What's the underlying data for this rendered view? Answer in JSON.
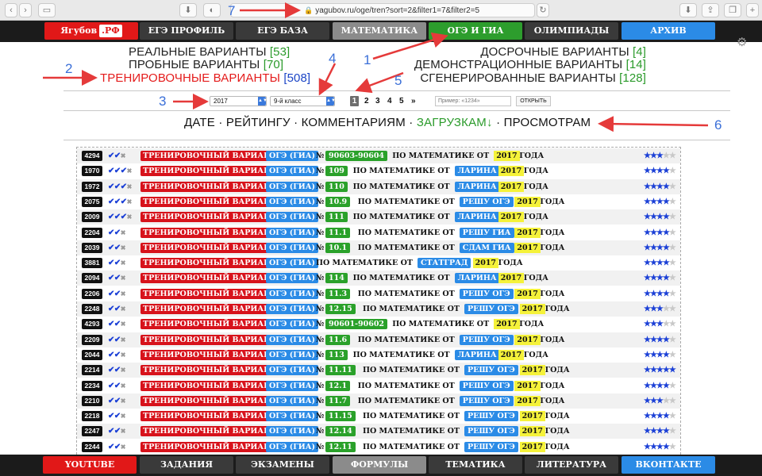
{
  "browser": {
    "url": "yagubov.ru/oge/tren?sort=2&filter1=7&filter2=5"
  },
  "top_nav": {
    "logo_text": "Ягубов",
    "logo_suffix": ".РФ",
    "items": [
      "ЕГЭ ПРОФИЛЬ",
      "ЕГЭ БАЗА",
      "МАТЕМАТИКА",
      "ОГЭ И ГИА",
      "ОЛИМПИАДЫ",
      "АРХИВ"
    ]
  },
  "categories": {
    "left": [
      {
        "label": "РЕАЛЬНЫЕ ВАРИАНТЫ",
        "count": "[53]"
      },
      {
        "label": "ПРОБНЫЕ ВАРИАНТЫ",
        "count": "[70]"
      },
      {
        "label": "ТРЕНИРОВОЧНЫЕ ВАРИАНТЫ",
        "count": "[508]"
      }
    ],
    "right": [
      {
        "label": "ДОСРОЧНЫЕ ВАРИАНТЫ",
        "count": "[4]"
      },
      {
        "label": "ДЕМОНСТРАЦИОННЫЕ ВАРИАНТЫ",
        "count": "[14]"
      },
      {
        "label": "СГЕНЕРИРОВАННЫЕ ВАРИАНТЫ",
        "count": "[128]"
      }
    ]
  },
  "filters": {
    "year": "2017",
    "grade": "9-й класс",
    "pages": [
      "1",
      "2",
      "3",
      "4",
      "5",
      "»"
    ],
    "current_page": "1",
    "search_placeholder": "Пример: «1234»",
    "open_label": "ОТКРЫТЬ"
  },
  "sort": {
    "prefix": "ДАТЕ · РЕЙТИНГУ · КОММЕНТАРИЯМ ·",
    "active": "ЗАГРУЗКАМ↓",
    "suffix": "· ПРОСМОТРАМ"
  },
  "row_text": {
    "type": "ТРЕНИРОВОЧНЫЙ ВАРИАНТ",
    "exam": "ОГЭ (ГИА)",
    "num_sign": "№",
    "subject": "ПО МАТЕМАТИКЕ",
    "from": "ОТ",
    "year_word": "ГОДА"
  },
  "rows": [
    {
      "id": "4294",
      "checks": "✔✔",
      "num": "90603-90604",
      "source": "",
      "year": "2017",
      "stars": 3
    },
    {
      "id": "1970",
      "checks": "✔✔✔",
      "num": "109",
      "source": "ЛАРИНА",
      "year": "2017",
      "stars": 4
    },
    {
      "id": "1972",
      "checks": "✔✔✔",
      "num": "110",
      "source": "ЛАРИНА",
      "year": "2017",
      "stars": 4
    },
    {
      "id": "2075",
      "checks": "✔✔✔",
      "num": "10.9",
      "source": "РЕШУ ОГЭ",
      "year": "2017",
      "stars": 4
    },
    {
      "id": "2009",
      "checks": "✔✔✔",
      "num": "111",
      "source": "ЛАРИНА",
      "year": "2017",
      "stars": 4
    },
    {
      "id": "2204",
      "checks": "✔✔",
      "num": "11.1",
      "source": "РЕШУ ГИА",
      "year": "2017",
      "stars": 4
    },
    {
      "id": "2039",
      "checks": "✔✔",
      "num": "10.1",
      "source": "СДАМ ГИА",
      "year": "2017",
      "stars": 4
    },
    {
      "id": "3881",
      "checks": "✔✔",
      "num": "",
      "source": "СТАТГРАД",
      "year": "2017",
      "stars": 4
    },
    {
      "id": "2094",
      "checks": "✔✔",
      "num": "114",
      "source": "ЛАРИНА",
      "year": "2017",
      "stars": 4
    },
    {
      "id": "2206",
      "checks": "✔✔",
      "num": "11.3",
      "source": "РЕШУ ОГЭ",
      "year": "2017",
      "stars": 4
    },
    {
      "id": "2248",
      "checks": "✔✔",
      "num": "12.15",
      "source": "РЕШУ ОГЭ",
      "year": "2017",
      "stars": 3
    },
    {
      "id": "4293",
      "checks": "✔✔",
      "num": "90601-90602",
      "source": "",
      "year": "2017",
      "stars": 3
    },
    {
      "id": "2209",
      "checks": "✔✔",
      "num": "11.6",
      "source": "РЕШУ ОГЭ",
      "year": "2017",
      "stars": 4
    },
    {
      "id": "2044",
      "checks": "✔✔",
      "num": "113",
      "source": "ЛАРИНА",
      "year": "2017",
      "stars": 4
    },
    {
      "id": "2214",
      "checks": "✔✔",
      "num": "11.11",
      "source": "РЕШУ ОГЭ",
      "year": "2017",
      "stars": 5
    },
    {
      "id": "2234",
      "checks": "✔✔",
      "num": "12.1",
      "source": "РЕШУ ОГЭ",
      "year": "2017",
      "stars": 4
    },
    {
      "id": "2210",
      "checks": "✔✔",
      "num": "11.7",
      "source": "РЕШУ ОГЭ",
      "year": "2017",
      "stars": 3
    },
    {
      "id": "2218",
      "checks": "✔✔",
      "num": "11.15",
      "source": "РЕШУ ОГЭ",
      "year": "2017",
      "stars": 4
    },
    {
      "id": "2247",
      "checks": "✔✔",
      "num": "12.14",
      "source": "РЕШУ ОГЭ",
      "year": "2017",
      "stars": 4
    },
    {
      "id": "2244",
      "checks": "✔✔",
      "num": "12.11",
      "source": "РЕШУ ОГЭ",
      "year": "2017",
      "stars": 4
    }
  ],
  "bottom_nav": {
    "items": [
      "YOUTUBE",
      "ЗАДАНИЯ",
      "ЭКЗАМЕНЫ",
      "ФОРМУЛЫ",
      "ТЕМАТИКА",
      "ЛИТЕРАТУРА",
      "ВКОНТАКТЕ"
    ]
  },
  "annotations": [
    "1",
    "2",
    "3",
    "4",
    "5",
    "6",
    "7"
  ]
}
